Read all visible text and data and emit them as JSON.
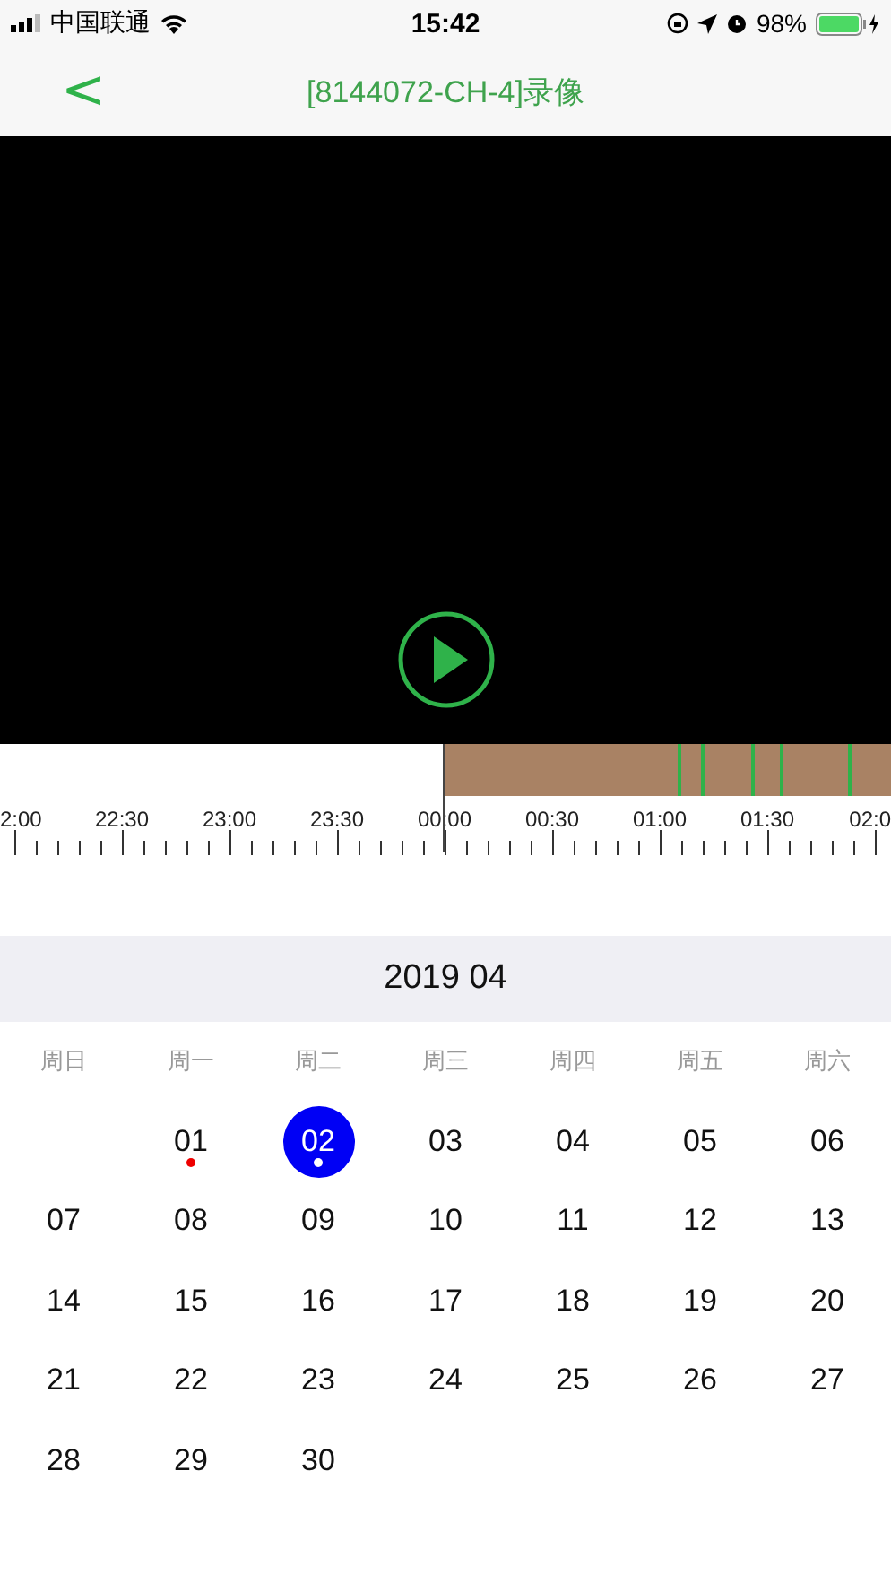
{
  "status_bar": {
    "carrier": "中国联通",
    "time": "15:42",
    "battery": "98%"
  },
  "nav": {
    "back": "<",
    "title": "[8144072-CH-4]录像"
  },
  "timeline": {
    "labels": [
      "2:00",
      "22:30",
      "23:00",
      "23:30",
      "00:00",
      "00:30",
      "01:00",
      "01:30",
      "02:0"
    ]
  },
  "calendar": {
    "month": "2019 04",
    "weekdays": [
      "周日",
      "周一",
      "周二",
      "周三",
      "周四",
      "周五",
      "周六"
    ],
    "days": [
      {
        "label": "01",
        "selected": false,
        "marked": true
      },
      {
        "label": "02",
        "selected": true,
        "marked": true
      },
      {
        "label": "03",
        "selected": false,
        "marked": false
      },
      {
        "label": "04",
        "selected": false,
        "marked": false
      },
      {
        "label": "05",
        "selected": false,
        "marked": false
      },
      {
        "label": "06",
        "selected": false,
        "marked": false
      },
      {
        "label": "07",
        "selected": false,
        "marked": false
      },
      {
        "label": "08",
        "selected": false,
        "marked": false
      },
      {
        "label": "09",
        "selected": false,
        "marked": false
      },
      {
        "label": "10",
        "selected": false,
        "marked": false
      },
      {
        "label": "11",
        "selected": false,
        "marked": false
      },
      {
        "label": "12",
        "selected": false,
        "marked": false
      },
      {
        "label": "13",
        "selected": false,
        "marked": false
      },
      {
        "label": "14",
        "selected": false,
        "marked": false
      },
      {
        "label": "15",
        "selected": false,
        "marked": false
      },
      {
        "label": "16",
        "selected": false,
        "marked": false
      },
      {
        "label": "17",
        "selected": false,
        "marked": false
      },
      {
        "label": "18",
        "selected": false,
        "marked": false
      },
      {
        "label": "19",
        "selected": false,
        "marked": false
      },
      {
        "label": "20",
        "selected": false,
        "marked": false
      },
      {
        "label": "21",
        "selected": false,
        "marked": false
      },
      {
        "label": "22",
        "selected": false,
        "marked": false
      },
      {
        "label": "23",
        "selected": false,
        "marked": false
      },
      {
        "label": "24",
        "selected": false,
        "marked": false
      },
      {
        "label": "25",
        "selected": false,
        "marked": false
      },
      {
        "label": "26",
        "selected": false,
        "marked": false
      },
      {
        "label": "27",
        "selected": false,
        "marked": false
      },
      {
        "label": "28",
        "selected": false,
        "marked": false
      },
      {
        "label": "29",
        "selected": false,
        "marked": false
      },
      {
        "label": "30",
        "selected": false,
        "marked": false
      }
    ]
  }
}
